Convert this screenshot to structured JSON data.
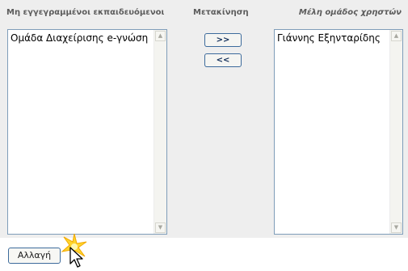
{
  "headers": {
    "not_enrolled": "Μη εγγεγραμμένοι εκπαιδευόμενοι",
    "move": "Μετακίνηση",
    "group_members": "Μέλη ομάδος χρηστών"
  },
  "left_list": {
    "items": [
      "Ομάδα Διαχείρισης e-γνώση"
    ]
  },
  "right_list": {
    "items": [
      "Γιάννης Εξηνταρίδης"
    ]
  },
  "buttons": {
    "move_right": ">>",
    "move_left": "<<",
    "submit": "Αλλαγή"
  },
  "colors": {
    "panel_bg": "#eeeeee",
    "border_accent": "#3d6b9c",
    "listbox_border": "#7f9db9"
  },
  "icons": [
    "scroll-up-arrow-icon",
    "scroll-down-arrow-icon",
    "sparkle-icon",
    "mouse-pointer-icon"
  ]
}
